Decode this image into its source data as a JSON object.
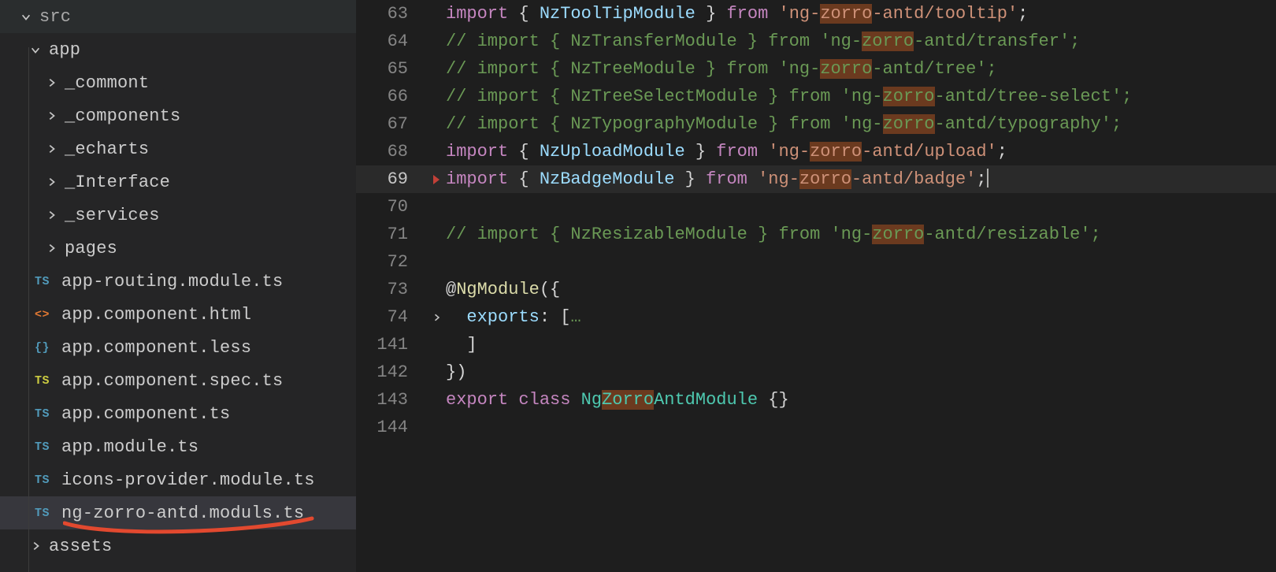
{
  "sidebar": {
    "root": "src",
    "app": "app",
    "folders": [
      "_commont",
      "_components",
      "_echarts",
      "_Interface",
      "_services",
      "pages"
    ],
    "files": [
      {
        "icon": "ts",
        "label": "app-routing.module.ts"
      },
      {
        "icon": "html",
        "label": "app.component.html"
      },
      {
        "icon": "less",
        "label": "app.component.less"
      },
      {
        "icon": "ts-y",
        "label": "app.component.spec.ts"
      },
      {
        "icon": "ts",
        "label": "app.component.ts"
      },
      {
        "icon": "ts",
        "label": "app.module.ts"
      },
      {
        "icon": "ts",
        "label": "icons-provider.module.ts"
      },
      {
        "icon": "ts",
        "label": "ng-zorro-antd.moduls.ts",
        "active": true
      }
    ],
    "assets": "assets",
    "icon_text": {
      "ts": "TS",
      "ts-y": "TS",
      "html": "<>",
      "less": "{}"
    }
  },
  "editor": {
    "highlight": "zorro",
    "lines": [
      {
        "n": 63,
        "tokens": [
          {
            "t": "import",
            "c": "keyword"
          },
          {
            "t": " { ",
            "c": "punc"
          },
          {
            "t": "NzToolTipModule",
            "c": "id"
          },
          {
            "t": " } ",
            "c": "punc"
          },
          {
            "t": "from",
            "c": "keyword"
          },
          {
            "t": " ",
            "c": "punc"
          },
          {
            "t": "'ng-",
            "c": "string"
          },
          {
            "t": "zorro",
            "c": "string hl"
          },
          {
            "t": "-antd/tooltip'",
            "c": "string"
          },
          {
            "t": ";",
            "c": "punc"
          }
        ]
      },
      {
        "n": 64,
        "tokens": [
          {
            "t": "// import { NzTransferModule } from 'ng-",
            "c": "comment"
          },
          {
            "t": "zorro",
            "c": "comment hl"
          },
          {
            "t": "-antd/transfer';",
            "c": "comment"
          }
        ]
      },
      {
        "n": 65,
        "tokens": [
          {
            "t": "// import { NzTreeModule } from 'ng-",
            "c": "comment"
          },
          {
            "t": "zorro",
            "c": "comment hl"
          },
          {
            "t": "-antd/tree';",
            "c": "comment"
          }
        ]
      },
      {
        "n": 66,
        "tokens": [
          {
            "t": "// import { NzTreeSelectModule } from 'ng-",
            "c": "comment"
          },
          {
            "t": "zorro",
            "c": "comment hl"
          },
          {
            "t": "-antd/tree-select';",
            "c": "comment"
          }
        ]
      },
      {
        "n": 67,
        "tokens": [
          {
            "t": "// import { NzTypographyModule } from 'ng-",
            "c": "comment"
          },
          {
            "t": "zorro",
            "c": "comment hl"
          },
          {
            "t": "-antd/typography';",
            "c": "comment"
          }
        ]
      },
      {
        "n": 68,
        "tokens": [
          {
            "t": "import",
            "c": "keyword"
          },
          {
            "t": " { ",
            "c": "punc"
          },
          {
            "t": "NzUploadModule",
            "c": "id"
          },
          {
            "t": " } ",
            "c": "punc"
          },
          {
            "t": "from",
            "c": "keyword"
          },
          {
            "t": " ",
            "c": "punc"
          },
          {
            "t": "'ng-",
            "c": "string"
          },
          {
            "t": "zorro",
            "c": "string hl"
          },
          {
            "t": "-antd/upload'",
            "c": "string"
          },
          {
            "t": ";",
            "c": "punc"
          }
        ]
      },
      {
        "n": 69,
        "current": true,
        "error": true,
        "tokens": [
          {
            "t": "import",
            "c": "keyword"
          },
          {
            "t": " { ",
            "c": "punc"
          },
          {
            "t": "NzBadgeModule",
            "c": "id"
          },
          {
            "t": " } ",
            "c": "punc"
          },
          {
            "t": "from",
            "c": "keyword"
          },
          {
            "t": " ",
            "c": "punc"
          },
          {
            "t": "'ng-",
            "c": "string"
          },
          {
            "t": "zorro",
            "c": "string hl"
          },
          {
            "t": "-antd/badge'",
            "c": "string"
          },
          {
            "t": ";",
            "c": "punc"
          },
          {
            "t": "",
            "c": "cursor"
          }
        ]
      },
      {
        "n": 70,
        "tokens": []
      },
      {
        "n": 71,
        "tokens": [
          {
            "t": "// import { NzResizableModule } from 'ng-",
            "c": "comment"
          },
          {
            "t": "zorro",
            "c": "comment hl"
          },
          {
            "t": "-antd/resizable';",
            "c": "comment"
          }
        ]
      },
      {
        "n": 72,
        "tokens": []
      },
      {
        "n": 73,
        "tokens": [
          {
            "t": "@",
            "c": "punc"
          },
          {
            "t": "NgModule",
            "c": "decor"
          },
          {
            "t": "({",
            "c": "punc"
          }
        ]
      },
      {
        "n": 74,
        "fold": true,
        "tokens": [
          {
            "t": "  ",
            "c": "punc"
          },
          {
            "t": "exports",
            "c": "id"
          },
          {
            "t": ": [",
            "c": "punc"
          },
          {
            "t": "…",
            "c": "comment"
          }
        ]
      },
      {
        "n": 141,
        "tokens": [
          {
            "t": "  ]",
            "c": "punc"
          }
        ]
      },
      {
        "n": 142,
        "tokens": [
          {
            "t": "})",
            "c": "punc"
          }
        ]
      },
      {
        "n": 143,
        "tokens": [
          {
            "t": "export",
            "c": "keyword"
          },
          {
            "t": " ",
            "c": "punc"
          },
          {
            "t": "class",
            "c": "keyword"
          },
          {
            "t": " ",
            "c": "punc"
          },
          {
            "t": "Ng",
            "c": "type"
          },
          {
            "t": "Zorro",
            "c": "type hl"
          },
          {
            "t": "AntdModule",
            "c": "type"
          },
          {
            "t": " {}",
            "c": "punc"
          }
        ]
      },
      {
        "n": 144,
        "tokens": []
      }
    ]
  }
}
